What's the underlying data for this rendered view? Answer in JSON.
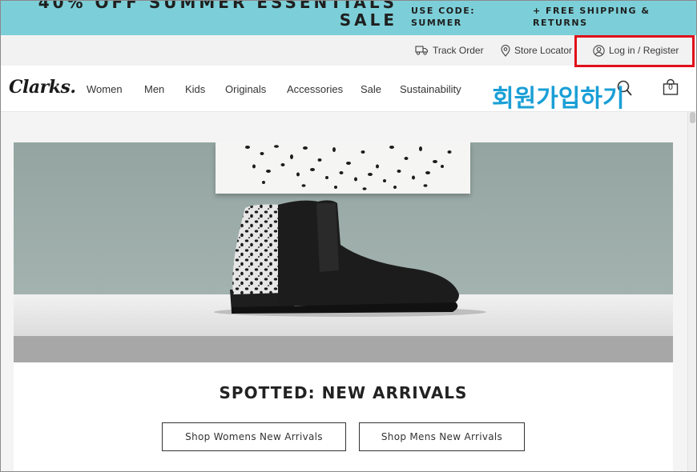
{
  "promo": {
    "headline_line1": "40% OFF SUMMER ESSENTIALS",
    "headline_line2": "SALE",
    "code_line1": "USE CODE:",
    "code_line2": "SUMMER",
    "shipping_line1": "+ FREE SHIPPING &",
    "shipping_line2": "RETURNS",
    "background": "#7ccfd8"
  },
  "utility": {
    "track_order": "Track Order",
    "store_locator": "Store Locator",
    "login_register": "Log in / Register",
    "highlight_color": "#e0101a"
  },
  "nav": {
    "logo": "Clarks.",
    "items": [
      "Women",
      "Men",
      "Kids",
      "Originals",
      "Accessories",
      "Sale",
      "Sustainability"
    ],
    "overlay_text": "회원가입하기",
    "overlay_color": "#1a9fd6",
    "bag_count": "0",
    "icons": [
      "search-icon",
      "bag-icon",
      "truck-icon",
      "location-pin-icon",
      "user-icon"
    ]
  },
  "hero": {
    "headline": "SPOTTED: NEW ARRIVALS",
    "buttons": [
      "Shop Womens New Arrivals",
      "Shop Mens New Arrivals"
    ]
  }
}
